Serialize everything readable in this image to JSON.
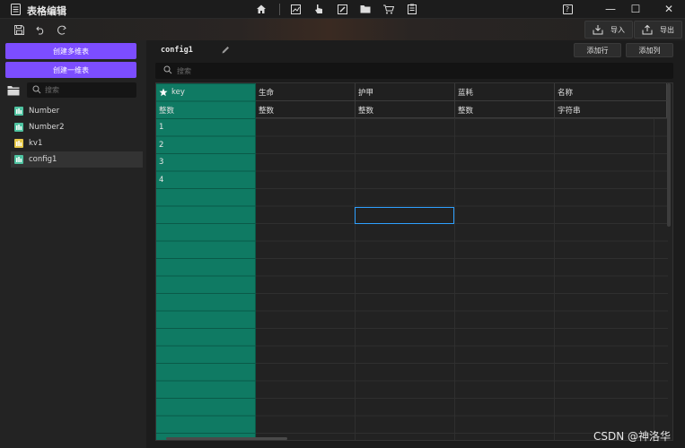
{
  "app": {
    "title": "表格编辑"
  },
  "header_nav_icons": [
    "home-icon",
    "chart-icon",
    "pointer-icon",
    "edit-doc-icon",
    "folder-icon",
    "cart-icon",
    "clipboard-icon"
  ],
  "window_controls": {
    "help": "?",
    "minimize": "—",
    "maximize": "☐",
    "close": "✕"
  },
  "toolbar": {
    "icons": [
      "save-icon",
      "undo-icon",
      "redo-icon"
    ],
    "import_label": "导入",
    "export_label": "导出"
  },
  "sidebar": {
    "create_multi_label": "创建多维表",
    "create_single_label": "创建一维表",
    "search_placeholder": "搜索",
    "items": [
      {
        "label": "Number",
        "icon": "table-icon",
        "color": "#4fc3a1",
        "active": false
      },
      {
        "label": "Number2",
        "icon": "table-icon",
        "color": "#4fc3a1",
        "active": false
      },
      {
        "label": "kv1",
        "icon": "table-icon",
        "color": "#e6c84a",
        "active": false
      },
      {
        "label": "config1",
        "icon": "table-icon",
        "color": "#4fc3a1",
        "active": true
      }
    ]
  },
  "main": {
    "config_name": "config1",
    "add_row_label": "添加行",
    "add_col_label": "添加列",
    "search_placeholder": "搜索",
    "table": {
      "columns": [
        {
          "name": "key",
          "type": "整数",
          "is_key": true
        },
        {
          "name": "生命",
          "type": "整数"
        },
        {
          "name": "护甲",
          "type": "整数"
        },
        {
          "name": "蓝耗",
          "type": "整数"
        },
        {
          "name": "名称",
          "type": "字符串"
        }
      ],
      "keys": [
        "1",
        "2",
        "3",
        "4"
      ]
    }
  },
  "colors": {
    "accent": "#7c4dff",
    "key_column": "#0f7a63",
    "selection": "#2ea0ff"
  },
  "watermark": "CSDN @神洛华"
}
